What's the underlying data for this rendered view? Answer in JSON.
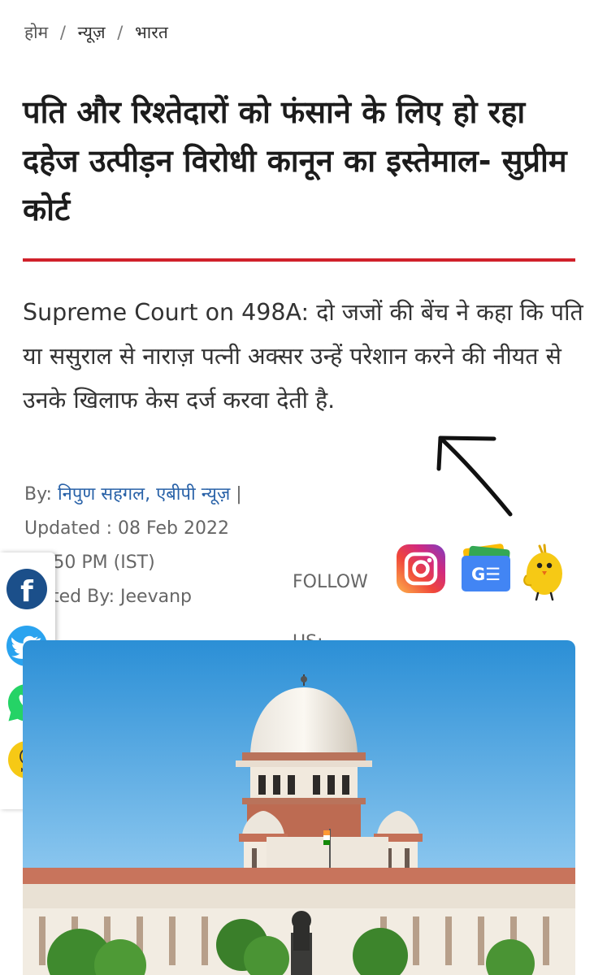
{
  "breadcrumb": {
    "home": "होम",
    "separator": "/",
    "news": "न्यूज़",
    "category": "भारत"
  },
  "article": {
    "headline": "पति और रिश्तेदारों को फंसाने के लिए हो रहा दहेज उत्पीड़न विरोधी कानून का इस्तेमाल- सुप्रीम कोर्ट",
    "summary": "Supreme Court on 498A: दो जजों की बेंच ने कहा कि पति या ससुराल से नाराज़ पत्नी अक्सर उन्हें परेशान करने की नीयत से उनके खिलाफ केस दर्ज करवा देती है."
  },
  "byline": {
    "by_label": "By:",
    "author": "निपुण सहगल, एबीपी न्यूज़",
    "divider": "|",
    "updated": "Updated : 08 Feb 2022",
    "time": "10:50 PM (IST)",
    "edited": "Edited By: Jeevanp"
  },
  "follow": {
    "label": "FOLLOW US:",
    "gnews_glyph": "G☰"
  },
  "share": {
    "koo_label": "Koo",
    "facebook_glyph": "f"
  },
  "colors": {
    "accent_red": "#d0212a",
    "author_link": "#2962a8",
    "facebook": "#1b4f8a",
    "twitter": "#2aa3ef",
    "whatsapp": "#25d366",
    "koo": "#f6c915"
  },
  "icons": [
    "instagram-icon",
    "google-news-icon",
    "koo-icon",
    "facebook-icon",
    "twitter-icon",
    "whatsapp-icon",
    "hand-drawn-arrow-icon"
  ]
}
